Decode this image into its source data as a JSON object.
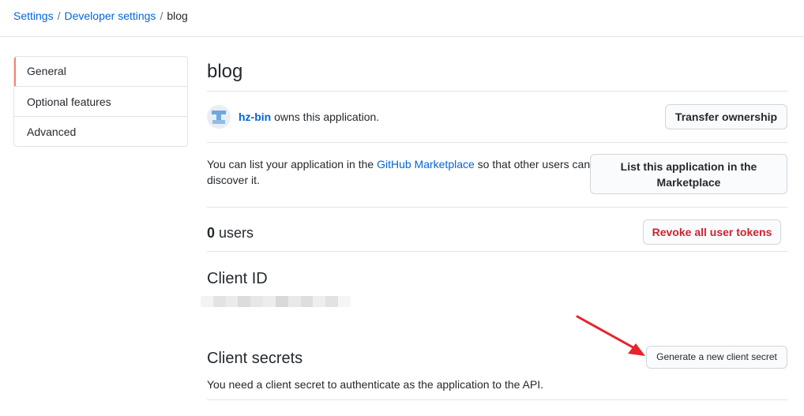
{
  "breadcrumb": {
    "settings": "Settings",
    "sep1": "/",
    "developer": "Developer settings",
    "sep2": "/",
    "current": "blog"
  },
  "sidebar": {
    "items": [
      {
        "label": "General",
        "active": true
      },
      {
        "label": "Optional features",
        "active": false
      },
      {
        "label": "Advanced",
        "active": false
      }
    ]
  },
  "app": {
    "title": "blog",
    "owner_name": "hz-bin",
    "owner_suffix": " owns this application.",
    "transfer_label": "Transfer ownership"
  },
  "marketplace": {
    "text_before": "You can list your application in the ",
    "link": "GitHub Marketplace",
    "text_after": " so that other users can discover it.",
    "button_label": "List this application in the Marketplace"
  },
  "users": {
    "count": "0",
    "suffix": " users",
    "revoke_label": "Revoke all user tokens"
  },
  "client_id": {
    "heading": "Client ID"
  },
  "client_secrets": {
    "heading": "Client secrets",
    "generate_label": "Generate a new client secret",
    "note": "You need a client secret to authenticate as the application to the API."
  },
  "colors": {
    "link": "#0366d6",
    "danger": "#cb2431",
    "active_indicator": "#f9826c",
    "annotation_arrow": "#e8232a"
  },
  "icons": {
    "avatar": "identicon-avatar",
    "arrow": "red-annotation-arrow"
  }
}
